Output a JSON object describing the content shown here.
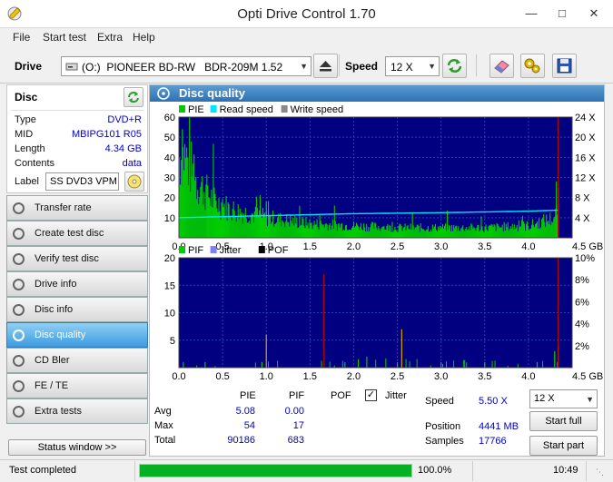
{
  "window": {
    "title": "Opti Drive Control 1.70"
  },
  "menu": [
    "File",
    "Start test",
    "Extra",
    "Help"
  ],
  "drivebar": {
    "drive_label": "Drive",
    "drive_value": "(O:)  PIONEER BD-RW   BDR-209M 1.52",
    "speed_label": "Speed",
    "speed_value": "12 X"
  },
  "disc": {
    "header": "Disc",
    "rows": [
      {
        "key": "Type",
        "value": "DVD+R"
      },
      {
        "key": "MID",
        "value": "MBIPG101 R05"
      },
      {
        "key": "Length",
        "value": "4.34 GB"
      },
      {
        "key": "Contents",
        "value": "data"
      }
    ],
    "label_key": "Label",
    "label_value": "SS DVD3 VPM"
  },
  "nav": [
    {
      "id": "transfer-rate",
      "label": "Transfer rate",
      "active": false
    },
    {
      "id": "create-test-disc",
      "label": "Create test disc",
      "active": false
    },
    {
      "id": "verify-test-disc",
      "label": "Verify test disc",
      "active": false
    },
    {
      "id": "drive-info",
      "label": "Drive info",
      "active": false
    },
    {
      "id": "disc-info",
      "label": "Disc info",
      "active": false
    },
    {
      "id": "disc-quality",
      "label": "Disc quality",
      "active": true
    },
    {
      "id": "cd-bler",
      "label": "CD Bler",
      "active": false
    },
    {
      "id": "fe-te",
      "label": "FE / TE",
      "active": false
    },
    {
      "id": "extra-tests",
      "label": "Extra tests",
      "active": false
    }
  ],
  "status_window_label": "Status window >>",
  "panel_title": "Disc quality",
  "colors": {
    "pie": "#00cc00",
    "read_speed": "#00e5ff",
    "write_speed": "#8a8a8a",
    "pif": "#00cc00",
    "jitter": "#8080ff",
    "pof": "#000000",
    "plot_bg": "#000080"
  },
  "chart_data": [
    {
      "type": "area",
      "legend": [
        "PIE",
        "Read speed",
        "Write speed"
      ],
      "x_ticks": [
        "0.0",
        "0.5",
        "1.0",
        "1.5",
        "2.0",
        "2.5",
        "3.0",
        "3.5",
        "4.0",
        "4.5 GB"
      ],
      "xlim": [
        0,
        4.5
      ],
      "y_ticks_left": [
        "60",
        "50",
        "40",
        "30",
        "20",
        "10"
      ],
      "ylim_left": [
        0,
        60
      ],
      "y_ticks_right": [
        "24 X",
        "20 X",
        "16 X",
        "12 X",
        "8 X",
        "4 X"
      ],
      "ylim_right": [
        0,
        24
      ],
      "pie_profile": [
        [
          0,
          40
        ],
        [
          0.05,
          42
        ],
        [
          0.2,
          28
        ],
        [
          0.4,
          18
        ],
        [
          0.6,
          14
        ],
        [
          0.8,
          12
        ],
        [
          1.0,
          10
        ],
        [
          1.5,
          7
        ],
        [
          2.0,
          6
        ],
        [
          2.5,
          5
        ],
        [
          3.0,
          5
        ],
        [
          3.5,
          5
        ],
        [
          4.0,
          6
        ],
        [
          4.3,
          10
        ],
        [
          4.34,
          18
        ]
      ],
      "pie_spikes": [
        [
          0.04,
          54
        ],
        [
          0.33,
          26
        ],
        [
          1.0,
          18
        ],
        [
          4.32,
          28
        ]
      ],
      "read_speed": [
        [
          0,
          4.0
        ],
        [
          0.5,
          4.2
        ],
        [
          1.0,
          4.4
        ],
        [
          2.0,
          4.8
        ],
        [
          3.0,
          5.0
        ],
        [
          4.0,
          5.3
        ],
        [
          4.34,
          5.5
        ]
      ],
      "marker_x": 4.34
    },
    {
      "type": "bar",
      "legend": [
        "PIF",
        "Jitter",
        "POF"
      ],
      "x_ticks": [
        "0.0",
        "0.5",
        "1.0",
        "1.5",
        "2.0",
        "2.5",
        "3.0",
        "3.5",
        "4.0",
        "4.5 GB"
      ],
      "xlim": [
        0,
        4.5
      ],
      "y_ticks_left": [
        "20",
        "15",
        "10",
        "5"
      ],
      "ylim_left": [
        0,
        20
      ],
      "y_ticks_right": [
        "10%",
        "8%",
        "6%",
        "4%",
        "2%"
      ],
      "ylim_right": [
        0,
        10
      ],
      "pif_spikes": [
        [
          0.05,
          1
        ],
        [
          0.3,
          1
        ],
        [
          0.95,
          1
        ],
        [
          1.0,
          6
        ],
        [
          1.66,
          17
        ],
        [
          1.9,
          1
        ],
        [
          2.15,
          2
        ],
        [
          2.5,
          1
        ],
        [
          2.55,
          7
        ],
        [
          3.0,
          1
        ],
        [
          3.5,
          1
        ],
        [
          4.1,
          1
        ],
        [
          4.3,
          3
        ],
        [
          4.34,
          4
        ]
      ],
      "marker_x": 4.34
    }
  ],
  "stats": {
    "columns": [
      "PIE",
      "PIF",
      "POF"
    ],
    "jitter_label": "Jitter",
    "jitter_checked": true,
    "rows": [
      {
        "label": "Avg",
        "pie": "5.08",
        "pif": "0.00"
      },
      {
        "label": "Max",
        "pie": "54",
        "pif": "17"
      },
      {
        "label": "Total",
        "pie": "90186",
        "pif": "683"
      }
    ],
    "speed_label": "Speed",
    "speed_value": "5.50 X",
    "position_label": "Position",
    "position_value": "4441 MB",
    "samples_label": "Samples",
    "samples_value": "17766",
    "speed_combo": "12 X",
    "start_full": "Start full",
    "start_part": "Start part"
  },
  "status": {
    "text": "Test completed",
    "progress_percent": 100,
    "progress_label": "100.0%",
    "time": "10:49"
  }
}
